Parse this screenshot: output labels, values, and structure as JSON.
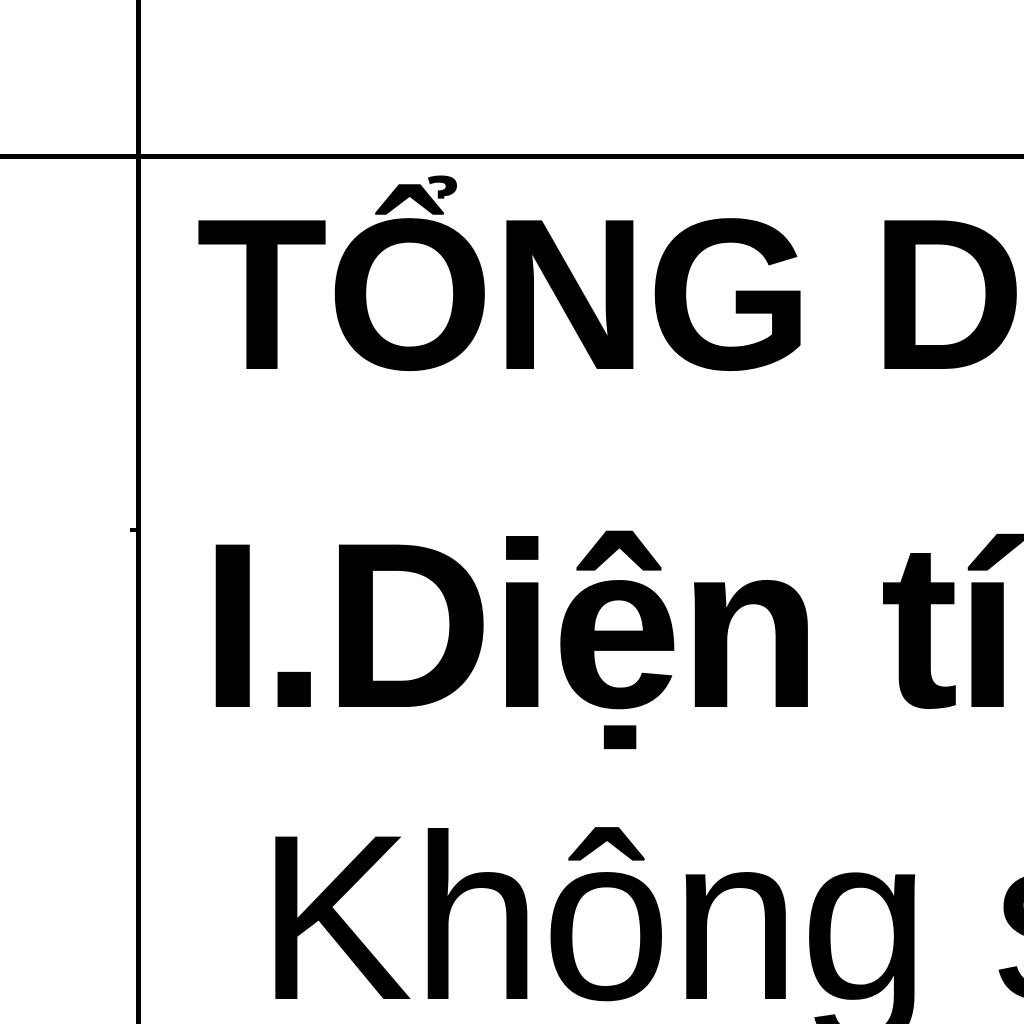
{
  "document": {
    "lines": [
      "TỔNG DI",
      "I.Diện tí",
      "Không s"
    ]
  }
}
